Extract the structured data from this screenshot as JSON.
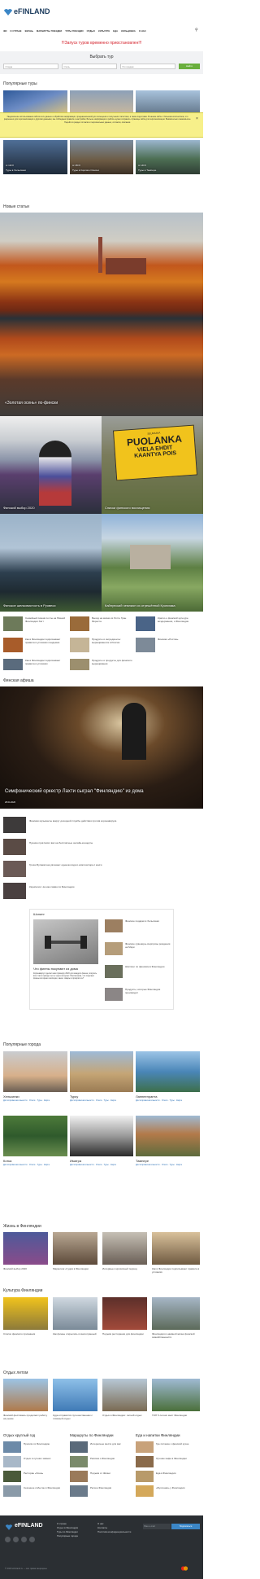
{
  "header": {
    "logo_text": "eFINLAND",
    "nav": [
      "ФИ",
      "О СТРАНЕ",
      "ЖИЗНЬ",
      "МАРШРУТЫ ПОЕЗДКИ",
      "ТУРЫ ПОЕЗДКИ",
      "ОТДЫХ",
      "КУЛЬТУРА",
      "ЕДА",
      "КОЛЬЦОВКА",
      "О НАС"
    ],
    "alert": "!!!Запуск туров временно приостановлен!!!"
  },
  "tour_search": {
    "title": "Выбрать тур",
    "field1": "Откуда",
    "field2": "Отель",
    "field3": "По городам",
    "button": "Найти"
  },
  "popular_tours": {
    "title": "Популярные туры",
    "items": [
      {
        "price": "от 120 €",
        "title": "Туры в Хельсинки"
      },
      {
        "price": "от 150 €",
        "title": "Туры в Корсико Олесни"
      },
      {
        "price": "от 140 €",
        "title": "Туры в Тампере"
      }
    ]
  },
  "cookie_notice": "Уведомление использования сайтом этих данных и обработки информации, предназначенной для посещения и получения статистики, а также подготовки. В нашем сайте с большим количеством, что разрешено для персонализации и другими данными, мы соблюдаем правила и настройки. Больше информации и работы нужно сохранять страницы сайта для персонализации. Внимательно ознакомьтесь: Перейти в раздел согласия и персональных данных, согласия, описании.",
  "new_articles": {
    "title": "Новые статьи",
    "hero_caption": "«Золотая осень» по-фински",
    "grid": [
      "Финский выбор 2020",
      "Списки финского восхищения",
      "Финское шелковистость в Руовеси",
      "Кайнунский чемпион из отрешённой Куопияма"
    ],
    "list": [
      "Семейный пикник почты на Южной Финляндии Хатт",
      "Выход на жизни из Лотте Гран Фореста",
      "Кратко о финской культуре воздержания, о Финляндии",
      "Как в Финляндии подписывают правила в условиях пандемии",
      "Продукты и ингредиенты: выращиваются в России",
      "Финская «Ростка»",
      "Как в Финляндии подписывают правила в условиях",
      "Продукты и продукты для финского выращивания"
    ]
  },
  "afisha": {
    "title": "Финская афиша",
    "hero_caption": "Симфонический оркестр Лахти сыграл \"Финляндию\" из дома",
    "hero_date": "28.04.2020",
    "items": [
      "Финская музыканты вокруг доходной службы действия против коронавируса",
      "Пушкин пригласил вас на бесплатные онлайн-концерты",
      "Гроза Мулакатона увлекает одна-молодого композитора с книги",
      "Кэрисалол: ёж как символ в Финляндии"
    ]
  },
  "shopping": {
    "title": "Шопинг",
    "main_caption": "Что финны покупают из дома",
    "main_text": "Коронавирус сделал нам проверку 2020 для каждого финна, покупать всё стало гораздо легче через интернет. Рассмотрим, что покупают финны во время изоляции, какие товары в приоритете?",
    "side": [
      "Финское подарки в Хельсинки",
      "Финские сувениры-сюрпризы рождения на Мэри",
      "Шоппинг по финским в Финляндии",
      "Продукты, которые Финляндия производит"
    ]
  },
  "cities": {
    "title": "Популярные города",
    "items": [
      {
        "name": "Хельсинки",
        "links": [
          "Достопримечательности",
          "Отели",
          "Туры",
          "Карта"
        ]
      },
      {
        "name": "Турку",
        "links": [
          "Достопримечательности",
          "Отели",
          "Туры",
          "Карта"
        ]
      },
      {
        "name": "Лаппеенранта",
        "links": [
          "Достопримечательности",
          "Отели",
          "Туры",
          "Карта"
        ]
      },
      {
        "name": "Котка",
        "links": [
          "Достопримечательности",
          "Отели",
          "Туры",
          "Карта"
        ]
      },
      {
        "name": "Иматра",
        "links": [
          "Достопримечательности",
          "Отели",
          "Туры",
          "Карта"
        ]
      },
      {
        "name": "Тампере",
        "links": [
          "Достопримечательности",
          "Отели",
          "Туры",
          "Карта"
        ]
      }
    ]
  },
  "life": {
    "title": "Жизнь в Финляндии",
    "items": [
      "Финский выбор 2020",
      "Маркетинг-студия в Финляндии",
      "Интервью в кризисный период",
      "Как в Финляндии подписывают правила в условиях"
    ]
  },
  "culture": {
    "title": "Культура Финляндии",
    "items": [
      "Список финского признания",
      "Как финны открылись в многогранный",
      "Подъём ресторанов для финляндии",
      "Финляндия в наивной жизни финской семейственности"
    ]
  },
  "rest": {
    "title": "Отдых летом",
    "items": [
      "Финский фестиваль продолжит работу на рынке",
      "Куда отправится путешественник с пляжный отдых",
      "Отдых в Финляндии: летний отдых",
      "ТОП 5 летних мест Финляндии"
    ]
  },
  "bottom_cols": [
    {
      "title": "Отдых круглый год",
      "items": [
        "Пролив к в Финляндию",
        "Отдых в лучших зимних",
        "Ресторан «Хона»",
        "Сезонное событие в Финляндии"
      ]
    },
    {
      "title": "Маршруты по Финляндии",
      "items": [
        "Интересные места для вас",
        "Рассказ о Финляндии",
        "Подъём от Жизни",
        "Регион Финляндии"
      ]
    },
    {
      "title": "Еда и напитки Финляндии",
      "items": [
        "Где питание к финской кухне",
        "Лучшие кафе в Финляндии",
        "Еда в Финляндии",
        "«Булочная» у Финляндии"
      ]
    }
  ],
  "footer": {
    "logo_text": "eFINLAND",
    "col1": [
      "О стране",
      "Отдых в Финляндии",
      "Туры по Финляндии",
      "Популярные города"
    ],
    "col2": [
      "О нас",
      "Контакты",
      "Политика конфиденциальности"
    ],
    "subscribe_placeholder": "Ваш e-mail",
    "subscribe_button": "Подписаться",
    "copyright": "© 2020 eFinland.ru — все права защищены"
  },
  "colors": {
    "accent": "#1a3a5c",
    "button": "#6aaf3d",
    "alert": "#d4202a",
    "footer": "#2b2f33"
  }
}
